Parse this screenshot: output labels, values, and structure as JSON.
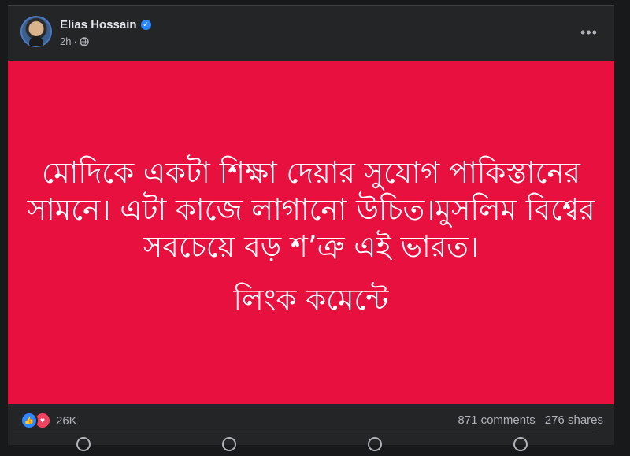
{
  "post": {
    "author": "Elias Hossain",
    "time": "2h",
    "separator": "·",
    "verified_icon": "verified-badge-icon",
    "privacy_icon": "globe-icon",
    "text_lines": "মোদিকে একটা শিক্ষা দেয়ার সুযোগ পাকিস্তানের\nসামনে। এটা কাজে লাগানো উচিত।মুসলিম বিশ্বের\nসবচেয়ে বড় শ’ত্রু এই ভারত।",
    "link_text": "লিংক কমেন্টে",
    "background_color": "#e8103f"
  },
  "stats": {
    "reaction_count": "26K",
    "comments": "871 comments",
    "shares": "276 shares"
  },
  "colors": {
    "brand_blue": "#2d88ff",
    "love_red": "#f3425f",
    "card_bg": "#242526"
  }
}
